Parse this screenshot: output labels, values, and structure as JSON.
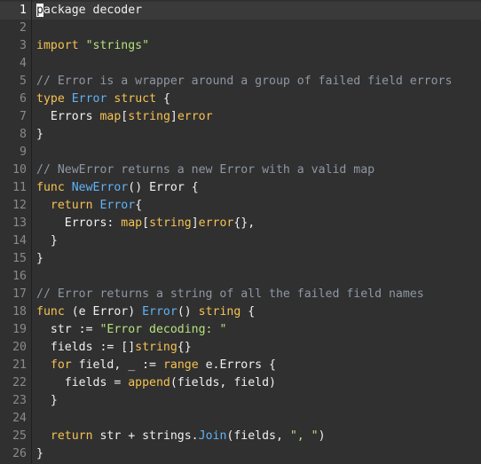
{
  "editor": {
    "cursor_line": 1,
    "colors": {
      "background": "#303030",
      "gutter_text": "#8a8a8a",
      "plain": "#f0f0f0",
      "keyword": "#f6c253",
      "type": "#5fb3f6",
      "string": "#b5e07f",
      "comment": "#8e97a3"
    },
    "lines": [
      {
        "n": "1",
        "tokens": [
          [
            "cursor",
            "p"
          ],
          [
            "plain",
            "ackage decoder"
          ]
        ]
      },
      {
        "n": "2",
        "tokens": []
      },
      {
        "n": "3",
        "tokens": [
          [
            "keyword",
            "import"
          ],
          [
            "plain",
            " "
          ],
          [
            "string",
            "\"strings\""
          ]
        ]
      },
      {
        "n": "4",
        "tokens": []
      },
      {
        "n": "5",
        "tokens": [
          [
            "comment",
            "// Error is a wrapper around a group of failed field errors"
          ]
        ]
      },
      {
        "n": "6",
        "tokens": [
          [
            "keyword",
            "type"
          ],
          [
            "plain",
            " "
          ],
          [
            "type",
            "Error"
          ],
          [
            "plain",
            " "
          ],
          [
            "keyword",
            "struct"
          ],
          [
            "plain",
            " {"
          ]
        ]
      },
      {
        "n": "7",
        "tokens": [
          [
            "plain",
            "  Errors "
          ],
          [
            "keyword",
            "map"
          ],
          [
            "plain",
            "["
          ],
          [
            "keyword",
            "string"
          ],
          [
            "plain",
            "]"
          ],
          [
            "keyword",
            "error"
          ]
        ]
      },
      {
        "n": "8",
        "tokens": [
          [
            "plain",
            "}"
          ]
        ]
      },
      {
        "n": "9",
        "tokens": []
      },
      {
        "n": "10",
        "tokens": [
          [
            "comment",
            "// NewError returns a new Error with a valid map"
          ]
        ]
      },
      {
        "n": "11",
        "tokens": [
          [
            "keyword",
            "func"
          ],
          [
            "plain",
            " "
          ],
          [
            "type",
            "NewError"
          ],
          [
            "plain",
            "() Error {"
          ]
        ]
      },
      {
        "n": "12",
        "tokens": [
          [
            "plain",
            "  "
          ],
          [
            "keyword",
            "return"
          ],
          [
            "plain",
            " "
          ],
          [
            "type",
            "Error"
          ],
          [
            "plain",
            "{"
          ]
        ]
      },
      {
        "n": "13",
        "tokens": [
          [
            "plain",
            "    Errors: "
          ],
          [
            "keyword",
            "map"
          ],
          [
            "plain",
            "["
          ],
          [
            "keyword",
            "string"
          ],
          [
            "plain",
            "]"
          ],
          [
            "keyword",
            "error"
          ],
          [
            "plain",
            "{},"
          ]
        ]
      },
      {
        "n": "14",
        "tokens": [
          [
            "plain",
            "  }"
          ]
        ]
      },
      {
        "n": "15",
        "tokens": [
          [
            "plain",
            "}"
          ]
        ]
      },
      {
        "n": "16",
        "tokens": []
      },
      {
        "n": "17",
        "tokens": [
          [
            "comment",
            "// Error returns a string of all the failed field names"
          ]
        ]
      },
      {
        "n": "18",
        "tokens": [
          [
            "keyword",
            "func"
          ],
          [
            "plain",
            " (e Error) "
          ],
          [
            "type",
            "Error"
          ],
          [
            "plain",
            "() "
          ],
          [
            "keyword",
            "string"
          ],
          [
            "plain",
            " {"
          ]
        ]
      },
      {
        "n": "19",
        "tokens": [
          [
            "plain",
            "  str := "
          ],
          [
            "string",
            "\"Error decoding: \""
          ]
        ]
      },
      {
        "n": "20",
        "tokens": [
          [
            "plain",
            "  fields := []"
          ],
          [
            "keyword",
            "string"
          ],
          [
            "plain",
            "{}"
          ]
        ]
      },
      {
        "n": "21",
        "tokens": [
          [
            "plain",
            "  "
          ],
          [
            "keyword",
            "for"
          ],
          [
            "plain",
            " field, _ := "
          ],
          [
            "keyword",
            "range"
          ],
          [
            "plain",
            " e.Errors {"
          ]
        ]
      },
      {
        "n": "22",
        "tokens": [
          [
            "plain",
            "    fields = "
          ],
          [
            "keyword",
            "append"
          ],
          [
            "plain",
            "(fields, field)"
          ]
        ]
      },
      {
        "n": "23",
        "tokens": [
          [
            "plain",
            "  }"
          ]
        ]
      },
      {
        "n": "24",
        "tokens": []
      },
      {
        "n": "25",
        "tokens": [
          [
            "plain",
            "  "
          ],
          [
            "keyword",
            "return"
          ],
          [
            "plain",
            " str + strings."
          ],
          [
            "type",
            "Join"
          ],
          [
            "plain",
            "(fields, "
          ],
          [
            "string",
            "\", \""
          ],
          [
            "plain",
            ")"
          ]
        ]
      },
      {
        "n": "26",
        "tokens": [
          [
            "plain",
            "}"
          ]
        ]
      }
    ]
  }
}
